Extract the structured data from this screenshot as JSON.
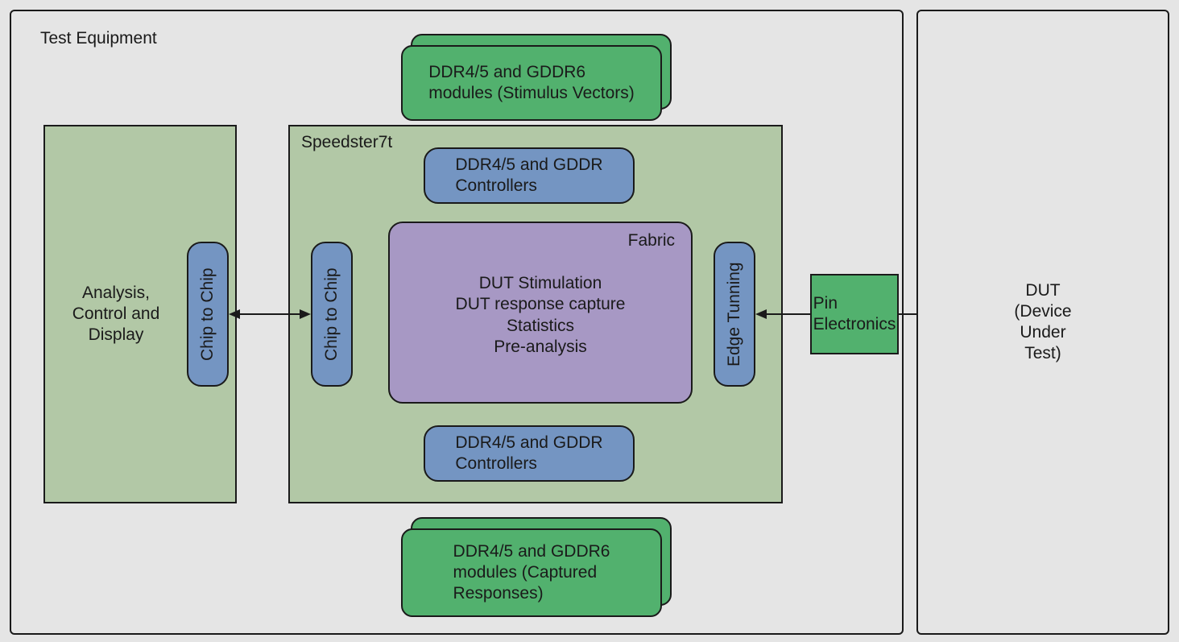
{
  "testEquipment": {
    "title": "Test Equipment"
  },
  "dut": {
    "line1": "DUT",
    "line2": "(Device",
    "line3": "Under",
    "line4": "Test)"
  },
  "analysis": {
    "line1": "Analysis,",
    "line2": "Control and",
    "line3": "Display"
  },
  "chipToChip1": "Chip to Chip",
  "chipToChip2": "Chip to Chip",
  "speedster": {
    "title": "Speedster7t"
  },
  "ddrControllersTop": {
    "line1": "DDR4/5 and GDDR",
    "line2": "Controllers"
  },
  "ddrControllersBottom": {
    "line1": "DDR4/5 and GDDR",
    "line2": "Controllers"
  },
  "fabric": {
    "title": "Fabric",
    "line1": "DUT Stimulation",
    "line2": "DUT response capture",
    "line3": "Statistics",
    "line4": "Pre-analysis"
  },
  "edgeTuning": "Edge Tunning",
  "modulesTop": {
    "line1": "DDR4/5 and GDDR6",
    "line2": "modules (Stimulus Vectors)"
  },
  "modulesBottom": {
    "line1": "DDR4/5 and GDDR6",
    "line2": "modules (Captured",
    "line3": "Responses)"
  },
  "pinElectronics": {
    "line1": "Pin",
    "line2": "Electronics"
  }
}
